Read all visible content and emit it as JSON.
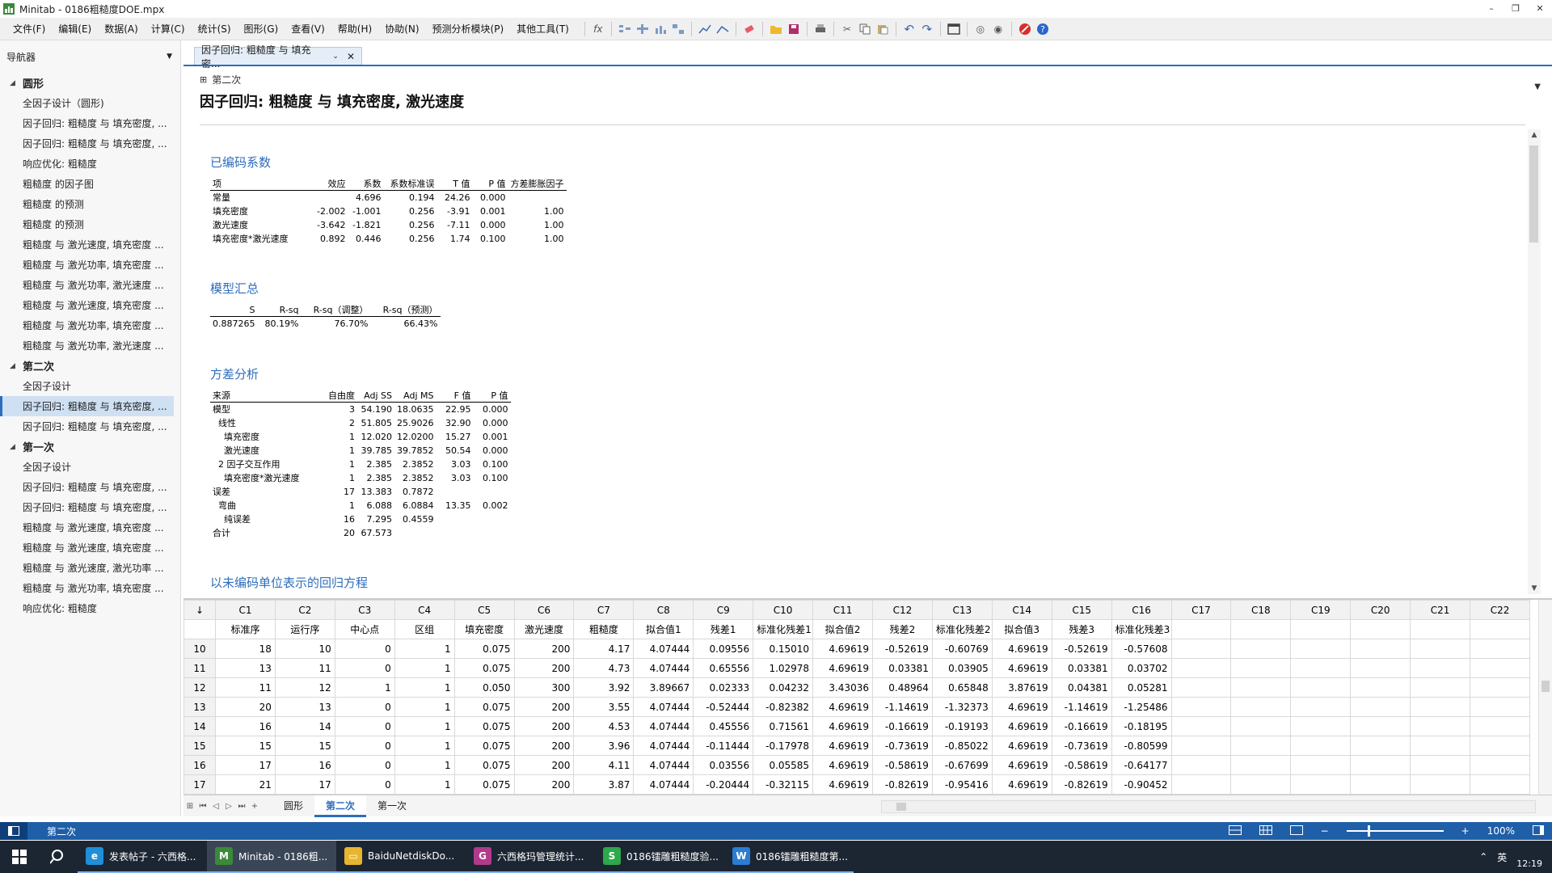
{
  "window": {
    "title": "Minitab - 0186粗糙度DOE.mpx",
    "controls": [
      "–",
      "❐",
      "✕"
    ]
  },
  "menu": [
    "文件(F)",
    "编辑(E)",
    "数据(A)",
    "计算(C)",
    "统计(S)",
    "图形(G)",
    "查看(V)",
    "帮助(H)",
    "协助(N)",
    "预测分析模块(P)",
    "其他工具(T)"
  ],
  "toolbar_icons": [
    "fx-icon",
    "table-tools-icon",
    "chart-tools-icon",
    "edit-icon",
    "open-folder-icon",
    "save-icon",
    "print-icon",
    "cut-icon",
    "copy-icon",
    "paste-icon",
    "undo-icon",
    "redo-icon",
    "window-icon",
    "binoculars-icon",
    "find-icon",
    "stop-icon",
    "help-icon"
  ],
  "navigator": {
    "title": "导航器",
    "groups": [
      {
        "label": "圆形",
        "items": [
          "全因子设计（圆形)",
          "因子回归: 粗糙度 与 填充密度, ...",
          "因子回归: 粗糙度 与 填充密度, ...",
          "响应优化: 粗糙度",
          "粗糙度 的因子图",
          "粗糙度 的预测",
          "粗糙度 的预测",
          "粗糙度 与 激光速度, 填充密度 ...",
          "粗糙度 与 激光功率, 填充密度 ...",
          "粗糙度 与 激光功率, 激光速度 ...",
          "粗糙度 与 激光速度, 填充密度 ...",
          "粗糙度 与 激光功率, 填充密度 ...",
          "粗糙度 与 激光功率, 激光速度 ..."
        ]
      },
      {
        "label": "第二次",
        "items": [
          "全因子设计",
          "因子回归: 粗糙度 与 填充密度, ...",
          "因子回归: 粗糙度 与 填充密度, ..."
        ],
        "selected_index": 1
      },
      {
        "label": "第一次",
        "items": [
          "全因子设计",
          "因子回归: 粗糙度 与 填充密度, ...",
          "因子回归: 粗糙度 与 填充密度, ...",
          "粗糙度 与 激光速度, 填充密度 ...",
          "粗糙度 与 激光速度, 填充密度 ...",
          "粗糙度 与 激光速度, 激光功率 ...",
          "粗糙度 与 激光功率, 填充密度 ...",
          "响应优化: 粗糙度"
        ]
      }
    ]
  },
  "report": {
    "tab_label": "因子回归: 粗糙度 与 填充密...",
    "section_label": "第二次",
    "title": "因子回归: 粗糙度 与 填充密度, 激光速度",
    "coef": {
      "title": "已编码系数",
      "headers": [
        "项",
        "效应",
        "系数",
        "系数标准误",
        "T 值",
        "P 值",
        "方差膨胀因子"
      ],
      "rows": [
        [
          "常量",
          "",
          "4.696",
          "0.194",
          "24.26",
          "0.000",
          ""
        ],
        [
          "填充密度",
          "-2.002",
          "-1.001",
          "0.256",
          "-3.91",
          "0.001",
          "1.00"
        ],
        [
          "激光速度",
          "-3.642",
          "-1.821",
          "0.256",
          "-7.11",
          "0.000",
          "1.00"
        ],
        [
          "填充密度*激光速度",
          "0.892",
          "0.446",
          "0.256",
          "1.74",
          "0.100",
          "1.00"
        ]
      ]
    },
    "summary": {
      "title": "模型汇总",
      "headers": [
        "S",
        "R-sq",
        "R-sq（调整）",
        "R-sq（预测）"
      ],
      "rows": [
        [
          "0.887265",
          "80.19%",
          "76.70%",
          "66.43%"
        ]
      ]
    },
    "anova": {
      "title": "方差分析",
      "headers": [
        "来源",
        "自由度",
        "Adj SS",
        "Adj MS",
        "F 值",
        "P 值"
      ],
      "rows": [
        [
          "模型",
          "3",
          "54.190",
          "18.0635",
          "22.95",
          "0.000"
        ],
        [
          "  线性",
          "2",
          "51.805",
          "25.9026",
          "32.90",
          "0.000"
        ],
        [
          "    填充密度",
          "1",
          "12.020",
          "12.0200",
          "15.27",
          "0.001"
        ],
        [
          "    激光速度",
          "1",
          "39.785",
          "39.7852",
          "50.54",
          "0.000"
        ],
        [
          "  2 因子交互作用",
          "1",
          "2.385",
          "2.3852",
          "3.03",
          "0.100"
        ],
        [
          "    填充密度*激光速度",
          "1",
          "2.385",
          "2.3852",
          "3.03",
          "0.100"
        ],
        [
          "误差",
          "17",
          "13.383",
          "0.7872",
          "",
          ""
        ],
        [
          "  弯曲",
          "1",
          "6.088",
          "6.0884",
          "13.35",
          "0.002"
        ],
        [
          "    纯误差",
          "16",
          "7.295",
          "0.4559",
          "",
          ""
        ],
        [
          "合计",
          "20",
          "67.573",
          "",
          "",
          ""
        ]
      ]
    },
    "equation_title": "以未编码单位表示的回归方程"
  },
  "worksheet": {
    "corner": "↓",
    "columns": [
      "C1",
      "C2",
      "C3",
      "C4",
      "C5",
      "C6",
      "C7",
      "C8",
      "C9",
      "C10",
      "C11",
      "C12",
      "C13",
      "C14",
      "C15",
      "C16",
      "C17",
      "C18",
      "C19",
      "C20",
      "C21",
      "C22"
    ],
    "names": [
      "标准序",
      "运行序",
      "中心点",
      "区组",
      "填充密度",
      "激光速度",
      "粗糙度",
      "拟合值1",
      "残差1",
      "标准化残差1",
      "拟合值2",
      "残差2",
      "标准化残差2",
      "拟合值3",
      "残差3",
      "标准化残差3",
      "",
      "",
      "",
      "",
      "",
      ""
    ],
    "rows": [
      {
        "n": "10",
        "v": [
          "18",
          "10",
          "0",
          "1",
          "0.075",
          "200",
          "4.17",
          "4.07444",
          "0.09556",
          "0.15010",
          "4.69619",
          "-0.52619",
          "-0.60769",
          "4.69619",
          "-0.52619",
          "-0.57608"
        ]
      },
      {
        "n": "11",
        "v": [
          "13",
          "11",
          "0",
          "1",
          "0.075",
          "200",
          "4.73",
          "4.07444",
          "0.65556",
          "1.02978",
          "4.69619",
          "0.03381",
          "0.03905",
          "4.69619",
          "0.03381",
          "0.03702"
        ]
      },
      {
        "n": "12",
        "v": [
          "11",
          "12",
          "1",
          "1",
          "0.050",
          "300",
          "3.92",
          "3.89667",
          "0.02333",
          "0.04232",
          "3.43036",
          "0.48964",
          "0.65848",
          "3.87619",
          "0.04381",
          "0.05281"
        ]
      },
      {
        "n": "13",
        "v": [
          "20",
          "13",
          "0",
          "1",
          "0.075",
          "200",
          "3.55",
          "4.07444",
          "-0.52444",
          "-0.82382",
          "4.69619",
          "-1.14619",
          "-1.32373",
          "4.69619",
          "-1.14619",
          "-1.25486"
        ]
      },
      {
        "n": "14",
        "v": [
          "16",
          "14",
          "0",
          "1",
          "0.075",
          "200",
          "4.53",
          "4.07444",
          "0.45556",
          "0.71561",
          "4.69619",
          "-0.16619",
          "-0.19193",
          "4.69619",
          "-0.16619",
          "-0.18195"
        ]
      },
      {
        "n": "15",
        "v": [
          "15",
          "15",
          "0",
          "1",
          "0.075",
          "200",
          "3.96",
          "4.07444",
          "-0.11444",
          "-0.17978",
          "4.69619",
          "-0.73619",
          "-0.85022",
          "4.69619",
          "-0.73619",
          "-0.80599"
        ]
      },
      {
        "n": "16",
        "v": [
          "17",
          "16",
          "0",
          "1",
          "0.075",
          "200",
          "4.11",
          "4.07444",
          "0.03556",
          "0.05585",
          "4.69619",
          "-0.58619",
          "-0.67699",
          "4.69619",
          "-0.58619",
          "-0.64177"
        ]
      },
      {
        "n": "17",
        "v": [
          "21",
          "17",
          "0",
          "1",
          "0.075",
          "200",
          "3.87",
          "4.07444",
          "-0.20444",
          "-0.32115",
          "4.69619",
          "-0.82619",
          "-0.95416",
          "4.69619",
          "-0.82619",
          "-0.90452"
        ]
      }
    ],
    "sheet_tabs": [
      "圆形",
      "第二次",
      "第一次"
    ],
    "active_sheet": "第二次"
  },
  "status": {
    "sheet": "第二次",
    "zoom": "100%",
    "zoom_level": 0.5
  },
  "taskbar": {
    "items": [
      {
        "label": "发表帖子 - 六西格...",
        "icon": "edge-icon",
        "color": "#1f8fd8",
        "glyph": "e"
      },
      {
        "label": "Minitab - 0186粗...",
        "icon": "minitab-icon",
        "color": "#3a8a3a",
        "glyph": "M"
      },
      {
        "label": "BaiduNetdiskDo...",
        "icon": "folder-icon",
        "color": "#e8b530",
        "glyph": "▭"
      },
      {
        "label": "六西格玛管理统计...",
        "icon": "pdf-icon",
        "color": "#b23a8a",
        "glyph": "G"
      },
      {
        "label": "0186镭雕粗糙度验...",
        "icon": "sheet-icon",
        "color": "#2da84a",
        "glyph": "S"
      },
      {
        "label": "0186镭雕粗糙度第...",
        "icon": "word-icon",
        "color": "#2b7cd3",
        "glyph": "W"
      }
    ],
    "tray": {
      "ime": "英",
      "time": "12:19"
    }
  }
}
